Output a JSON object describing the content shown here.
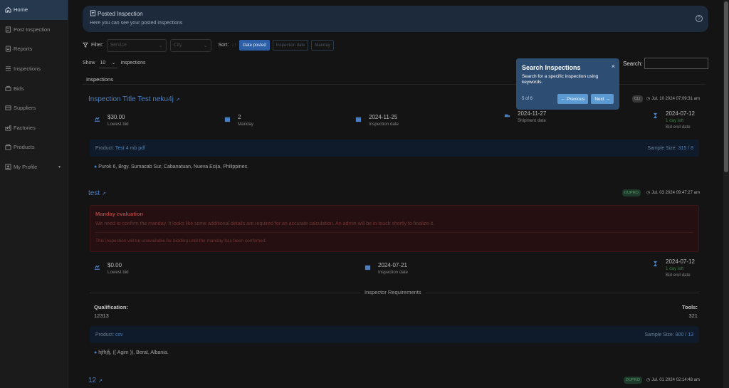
{
  "sidebar": {
    "items": [
      {
        "label": "Home",
        "icon": "home-icon",
        "active": true
      },
      {
        "label": "Post Inspection",
        "icon": "post-icon"
      },
      {
        "label": "Reports",
        "icon": "reports-icon"
      },
      {
        "label": "Inspections",
        "icon": "list-icon"
      },
      {
        "label": "Bids",
        "icon": "bids-icon"
      },
      {
        "label": "Suppliers",
        "icon": "suppliers-icon"
      },
      {
        "label": "Factories",
        "icon": "factory-icon"
      },
      {
        "label": "Products",
        "icon": "products-icon"
      },
      {
        "label": "My Profile",
        "icon": "profile-icon"
      }
    ]
  },
  "header": {
    "title": "Posted Inspection",
    "subtitle": "Here you can see your posted inspections"
  },
  "filters": {
    "label": "Filter:",
    "service_placeholder": "Service",
    "city_placeholder": "City",
    "sort_label": "Sort:",
    "sort_options": [
      "Date posted",
      "Inspection date",
      "Manday"
    ]
  },
  "list": {
    "show_label": "Show",
    "length_value": "10",
    "entries_label": "inspections",
    "search_label": "Search:",
    "section_title": "Inspections"
  },
  "cards": [
    {
      "title": "Inspection Title Test neku4j",
      "badge": "CLI",
      "date": "Jul. 10 2024 07:09:31 am",
      "stats": [
        {
          "value": "$30.00",
          "label": "Lowest bid",
          "icon": "money-icon"
        },
        {
          "value": "2",
          "label": "Manday",
          "icon": "calendar-icon"
        },
        {
          "value": "2024-11-25",
          "label": "Inspection date",
          "icon": "calendar-icon"
        },
        {
          "value": "2024-11-27",
          "label": "Shipment date",
          "icon": "truck-icon"
        },
        {
          "value": "2024-07-12",
          "note": "1 day left",
          "label": "Bid end date",
          "icon": "hourglass-icon"
        }
      ],
      "product_label": "Product:",
      "product": "Test 4 mb pdf",
      "sample_label": "Sample Size:",
      "sample": "315 / 8",
      "location": "Purok 6, Brgy. Sumacab Sur, Cabanatuan, Nueva Ecija, Philippines."
    },
    {
      "title": "test",
      "badge": "DUPRO",
      "date": "Jul. 03 2024 09:47:27 am",
      "warning_title": "Manday evaluation",
      "warning_text": "We need to confirm the manday. It looks like some additional details are required for an accurate calculation. An admin will be in touch shortly to finalize it.",
      "warning_note": "This inspection will be unavailable for bidding until the manday has been confirmed.",
      "stats": [
        {
          "value": "$0.00",
          "label": "Lowest bid",
          "icon": "money-icon"
        },
        {
          "value": "2024-07-21",
          "label": "Inspection date",
          "icon": "calendar-icon"
        },
        {
          "value": "2024-07-12",
          "note": "1 day left",
          "label": "Bid end date",
          "icon": "hourglass-icon"
        }
      ],
      "req_title": "Inspector Requirements",
      "qualification_label": "Qualification:",
      "qualification_value": "12313",
      "tools_label": "Tools:",
      "tools_value": "321",
      "product_label": "Product:",
      "product": "csv",
      "sample_label": "Sample Size:",
      "sample": "800 / 13",
      "location": "hjfhjfj, (( Agim )), Berat, Albania."
    },
    {
      "title": "12",
      "badge": "DUPRO",
      "date": "Jul. 01 2024 02:14:48 am"
    }
  ],
  "popover": {
    "title": "Search Inspections",
    "text": "Search for a specific inspection using keywords.",
    "progress": "5 of 6",
    "prev_label": "← Previous",
    "next_label": "Next →",
    "close": "×"
  },
  "colors": {
    "accent": "#4a7fc1",
    "sidebar_active": "#26384e",
    "popover_bg": "#2e4d73",
    "warning": "#a94340",
    "badge_green": "#3f7a4a"
  }
}
